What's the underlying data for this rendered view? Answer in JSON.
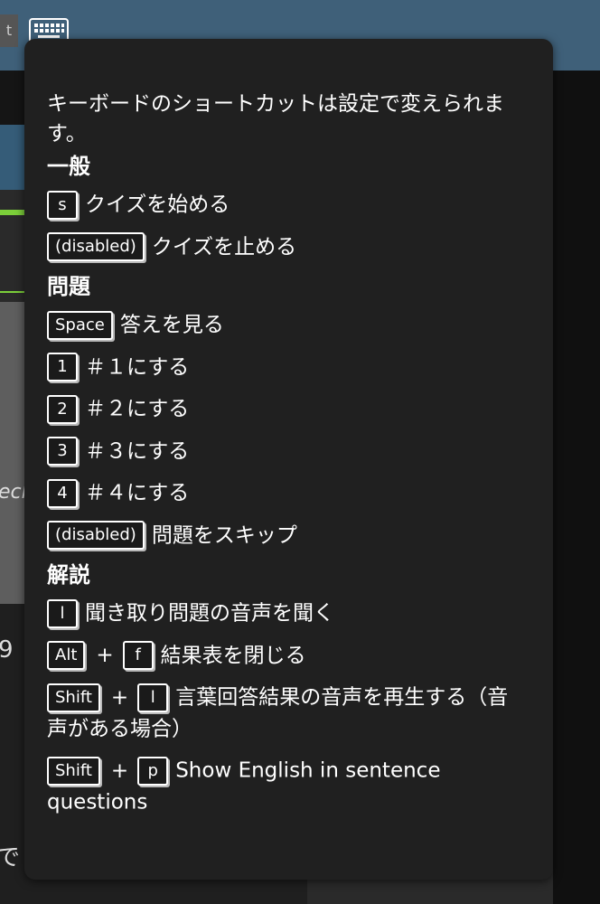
{
  "background": {
    "tab_label": "t",
    "fragments": [
      "ecl",
      "9",
      "で"
    ]
  },
  "popup": {
    "intro": "キーボードのショートカットは設定で変えられます。",
    "sections": [
      {
        "title": "一般",
        "items": [
          {
            "keys": [
              "s"
            ],
            "desc": "クイズを始める"
          },
          {
            "keys": [
              "(disabled)"
            ],
            "desc": "クイズを止める"
          }
        ]
      },
      {
        "title": "問題",
        "items": [
          {
            "keys": [
              "Space"
            ],
            "desc": "答えを見る"
          },
          {
            "keys": [
              "1"
            ],
            "desc": "＃１にする"
          },
          {
            "keys": [
              "2"
            ],
            "desc": "＃２にする"
          },
          {
            "keys": [
              "3"
            ],
            "desc": "＃３にする"
          },
          {
            "keys": [
              "4"
            ],
            "desc": "＃４にする"
          },
          {
            "keys": [
              "(disabled)"
            ],
            "desc": "問題をスキップ"
          }
        ]
      },
      {
        "title": "解説",
        "items": [
          {
            "keys": [
              "l"
            ],
            "desc": "聞き取り問題の音声を聞く"
          },
          {
            "keys": [
              "Alt",
              "f"
            ],
            "desc": "結果表を閉じる"
          },
          {
            "keys": [
              "Shift",
              "l"
            ],
            "desc": "言葉回答結果の音声を再生する（音声がある場合）"
          },
          {
            "keys": [
              "Shift",
              "p"
            ],
            "desc": "Show English in sentence questions"
          }
        ]
      }
    ],
    "plus": "+"
  },
  "colors": {
    "popup_bg": "#202020",
    "topbar": "#3f6079",
    "accent_green": "#7ccf3a"
  }
}
